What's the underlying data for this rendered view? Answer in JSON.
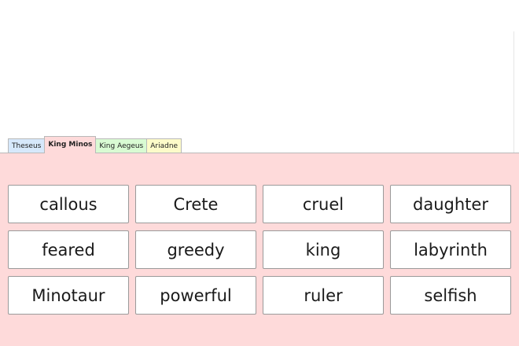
{
  "colors": {
    "panel_background": "#fedada",
    "theseus_tab": "#d6e8fb",
    "king_minos_tab": "#fedada",
    "king_aegeus_tab": "#d9fbd3",
    "ariadne_tab": "#fdfbc9"
  },
  "tabs": [
    {
      "label": "Theseus",
      "active": false
    },
    {
      "label": "King Minos",
      "active": true
    },
    {
      "label": "King Aegeus",
      "active": false
    },
    {
      "label": "Ariadne",
      "active": false
    }
  ],
  "words": [
    "callous",
    "Crete",
    "cruel",
    "daughter",
    "feared",
    "greedy",
    "king",
    "labyrinth",
    "Minotaur",
    "powerful",
    "ruler",
    "selfish"
  ]
}
